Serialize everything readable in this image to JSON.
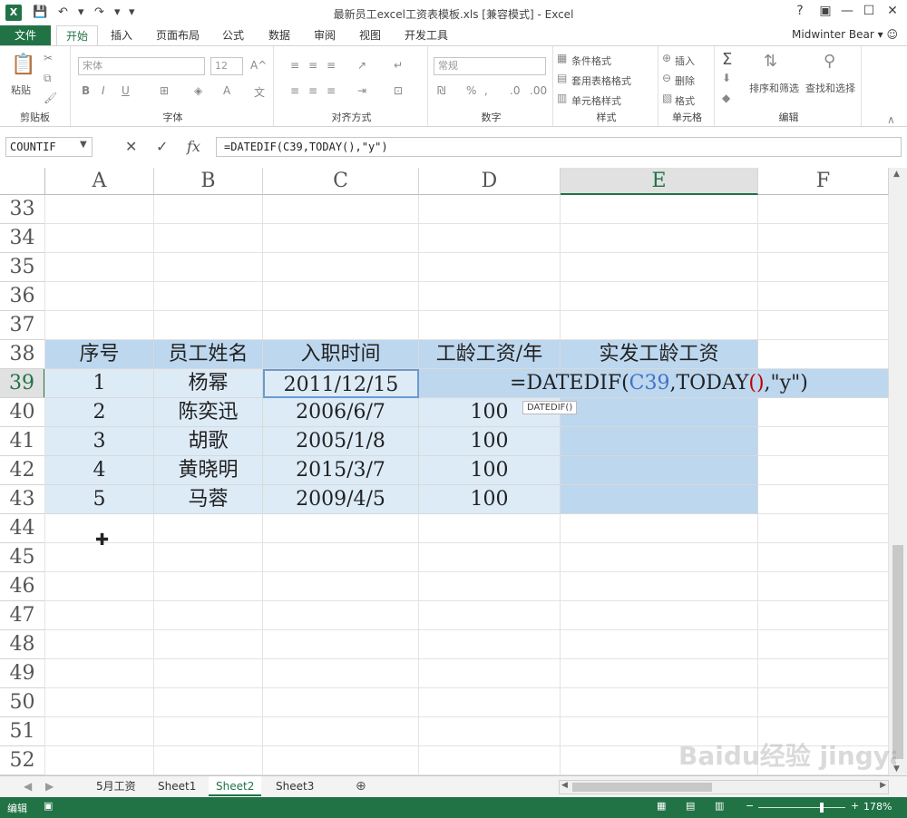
{
  "window": {
    "title": "最新员工excel工资表模板.xls  [兼容模式] - Excel",
    "app_icon": "X",
    "user": "Midwinter Bear",
    "help": "?"
  },
  "ribbon": {
    "file": "文件",
    "tabs": [
      "开始",
      "插入",
      "页面布局",
      "公式",
      "数据",
      "审阅",
      "视图",
      "开发工具"
    ],
    "groups": {
      "clipboard": {
        "label": "剪贴板",
        "paste": "粘贴"
      },
      "font": {
        "label": "字体",
        "font_name": "宋体",
        "font_size": "12"
      },
      "align": {
        "label": "对齐方式"
      },
      "number": {
        "label": "数字",
        "format": "常规"
      },
      "styles": {
        "label": "样式",
        "cond": "条件格式",
        "table": "套用表格格式",
        "cell": "单元格样式"
      },
      "cells": {
        "label": "单元格",
        "insert": "插入",
        "delete": "删除",
        "format": "格式"
      },
      "editing": {
        "label": "编辑",
        "sort": "排序和筛选",
        "find": "查找和选择"
      }
    }
  },
  "formula_bar": {
    "name_box": "COUNTIF",
    "formula": "=DATEDIF(C39,TODAY(),\"y\")"
  },
  "grid": {
    "columns": [
      "A",
      "B",
      "C",
      "D",
      "E",
      "F"
    ],
    "rows": [
      "33",
      "34",
      "35",
      "36",
      "37",
      "38",
      "39",
      "40",
      "41",
      "42",
      "43",
      "44",
      "45",
      "46",
      "47",
      "48",
      "49",
      "50",
      "51",
      "52"
    ],
    "header": [
      "序号",
      "员工姓名",
      "入职时间",
      "工龄工资/年",
      "实发工龄工资"
    ],
    "data": [
      [
        "1",
        "杨幂",
        "2011/12/15",
        ""
      ],
      [
        "2",
        "陈奕迅",
        "2006/6/7",
        "100"
      ],
      [
        "3",
        "胡歌",
        "2005/1/8",
        "100"
      ],
      [
        "4",
        "黄晓明",
        "2015/3/7",
        "100"
      ],
      [
        "5",
        "马蓉",
        "2009/4/5",
        "100"
      ]
    ],
    "edit": {
      "p1": "=DATEDIF(",
      "ref": "C39",
      "p2": ",TODAY",
      "paren": "()",
      "p3": ",\"y\")"
    },
    "tooltip": "DATEDIF()",
    "colors": {
      "header_fill": "#bdd7ee",
      "data_fill": "#ddebf7",
      "ref": "#4472c4",
      "paren": "#c00000",
      "accent": "#217346"
    }
  },
  "sheets": [
    "5月工资",
    "Sheet1",
    "Sheet2",
    "Sheet3"
  ],
  "active_sheet": "Sheet2",
  "status": {
    "mode": "编辑",
    "zoom": "178%"
  },
  "watermark": "Baidu经验 jingyan.baidu.com"
}
